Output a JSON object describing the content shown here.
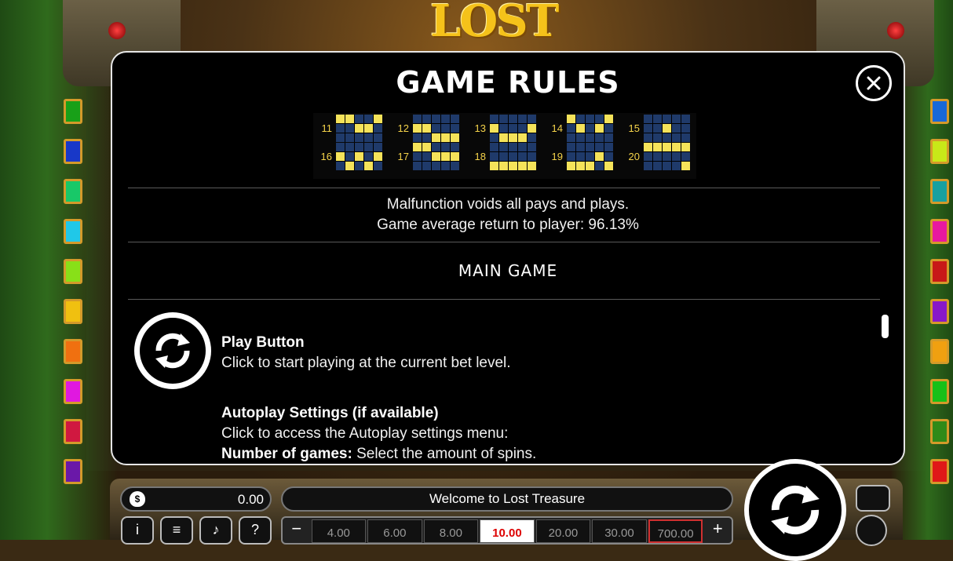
{
  "logo": {
    "text": "LOST"
  },
  "modal": {
    "title": "GAME RULES",
    "close_icon": "close-icon",
    "paylines": [
      {
        "num": "11",
        "cells": [
          1,
          1,
          0,
          0,
          1,
          0,
          0,
          1,
          1,
          0,
          0,
          0,
          0,
          0,
          0
        ]
      },
      {
        "num": "12",
        "cells": [
          0,
          0,
          0,
          0,
          0,
          1,
          1,
          0,
          0,
          0,
          0,
          0,
          1,
          1,
          1
        ]
      },
      {
        "num": "13",
        "cells": [
          0,
          0,
          0,
          0,
          0,
          1,
          0,
          0,
          0,
          1,
          0,
          1,
          1,
          1,
          0
        ]
      },
      {
        "num": "14",
        "cells": [
          1,
          0,
          0,
          0,
          1,
          0,
          1,
          0,
          1,
          0,
          0,
          0,
          0,
          0,
          0
        ]
      },
      {
        "num": "15",
        "cells": [
          0,
          0,
          0,
          0,
          0,
          0,
          0,
          1,
          0,
          0,
          0,
          0,
          0,
          0,
          0
        ]
      },
      {
        "num": "16",
        "cells": [
          0,
          0,
          0,
          0,
          0,
          1,
          0,
          1,
          0,
          1,
          0,
          1,
          0,
          1,
          0
        ]
      },
      {
        "num": "17",
        "cells": [
          1,
          1,
          0,
          0,
          0,
          0,
          0,
          1,
          1,
          1,
          0,
          0,
          0,
          0,
          0
        ]
      },
      {
        "num": "18",
        "cells": [
          0,
          0,
          0,
          0,
          0,
          0,
          0,
          0,
          0,
          0,
          1,
          1,
          1,
          1,
          1
        ]
      },
      {
        "num": "19",
        "cells": [
          0,
          0,
          0,
          0,
          0,
          0,
          0,
          0,
          1,
          0,
          1,
          1,
          1,
          0,
          1
        ]
      },
      {
        "num": "20",
        "cells": [
          1,
          1,
          1,
          1,
          1,
          0,
          0,
          0,
          0,
          0,
          0,
          0,
          0,
          0,
          1
        ]
      }
    ],
    "info_line1": "Malfunction voids all pays and plays.",
    "info_line2": "Game average return to player: 96.13%",
    "section_title": "MAIN GAME",
    "play_button_heading": "Play Button",
    "play_button_text": "Click to start playing at the current bet level.",
    "autoplay_heading": "Autoplay Settings (if available)",
    "autoplay_text": "Click to access the Autoplay settings menu:",
    "num_games_label": "Number of games:",
    "num_games_text": " Select the amount of spins."
  },
  "bottom": {
    "balance": "0.00",
    "message": "Welcome to Lost Treasure",
    "buttons": [
      "i",
      "≡",
      "♪",
      "?"
    ],
    "bets": [
      "4.00",
      "6.00",
      "8.00",
      "10.00",
      "20.00",
      "30.00",
      "700.00"
    ],
    "selected_bet": "10.00",
    "minus": "−",
    "plus": "+"
  },
  "colors": {
    "payline_on": "#f5e35a",
    "payline_off": "#1f3a6a",
    "tabs_left": [
      "#18a018",
      "#1838c8",
      "#18c868",
      "#20c8e8",
      "#88e018",
      "#f0c010",
      "#f07010",
      "#e018e0",
      "#d01840",
      "#6a18a8"
    ],
    "tabs_right": [
      "#1868d8",
      "#c8e818",
      "#18a0a0",
      "#e818a0",
      "#c81818",
      "#8818c8",
      "#f0a010",
      "#18c018",
      "#308a18",
      "#e01818"
    ]
  }
}
